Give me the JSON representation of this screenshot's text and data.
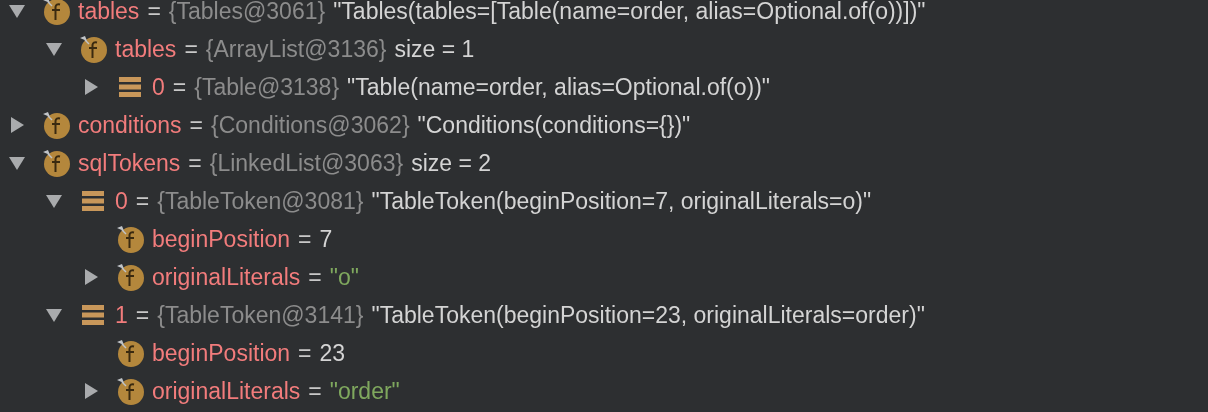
{
  "variables": [
    {
      "kind": "field",
      "name": "tables",
      "equals": "=",
      "type_ref": "{Tables@3061}",
      "value": {
        "kind": "summary",
        "text": "\"Tables(tables=[Table(name=order, alias=Optional.of(o))])\""
      },
      "expanded": true,
      "children": [
        {
          "kind": "field",
          "name": "tables",
          "equals": "=",
          "type_ref": "{ArrayList@3136}",
          "value": {
            "kind": "summary",
            "text": "size = 1"
          },
          "expanded": true,
          "children": [
            {
              "kind": "element",
              "name": "0",
              "equals": "=",
              "type_ref": "{Table@3138}",
              "value": {
                "kind": "summary",
                "text": "\"Table(name=order, alias=Optional.of(o))\""
              },
              "expanded": false
            }
          ]
        }
      ]
    },
    {
      "kind": "field",
      "name": "conditions",
      "equals": "=",
      "type_ref": "{Conditions@3062}",
      "value": {
        "kind": "summary",
        "text": "\"Conditions(conditions={})\""
      },
      "expanded": false
    },
    {
      "kind": "field",
      "name": "sqlTokens",
      "equals": "=",
      "type_ref": "{LinkedList@3063}",
      "value": {
        "kind": "summary",
        "text": "size = 2"
      },
      "expanded": true,
      "children": [
        {
          "kind": "element",
          "name": "0",
          "equals": "=",
          "type_ref": "{TableToken@3081}",
          "value": {
            "kind": "summary",
            "text": "\"TableToken(beginPosition=7, originalLiterals=o)\""
          },
          "expanded": true,
          "children": [
            {
              "kind": "field",
              "name": "beginPosition",
              "equals": "=",
              "value": {
                "kind": "summary",
                "text": "7"
              }
            },
            {
              "kind": "field",
              "name": "originalLiterals",
              "equals": "=",
              "value": {
                "kind": "string",
                "text": "\"o\""
              },
              "expanded": false
            }
          ]
        },
        {
          "kind": "element",
          "name": "1",
          "equals": "=",
          "type_ref": "{TableToken@3141}",
          "value": {
            "kind": "summary",
            "text": "\"TableToken(beginPosition=23, originalLiterals=order)\""
          },
          "expanded": true,
          "children": [
            {
              "kind": "field",
              "name": "beginPosition",
              "equals": "=",
              "value": {
                "kind": "summary",
                "text": "23"
              }
            },
            {
              "kind": "field",
              "name": "originalLiterals",
              "equals": "=",
              "value": {
                "kind": "string",
                "text": "\"order\""
              },
              "expanded": false
            }
          ]
        }
      ]
    }
  ]
}
